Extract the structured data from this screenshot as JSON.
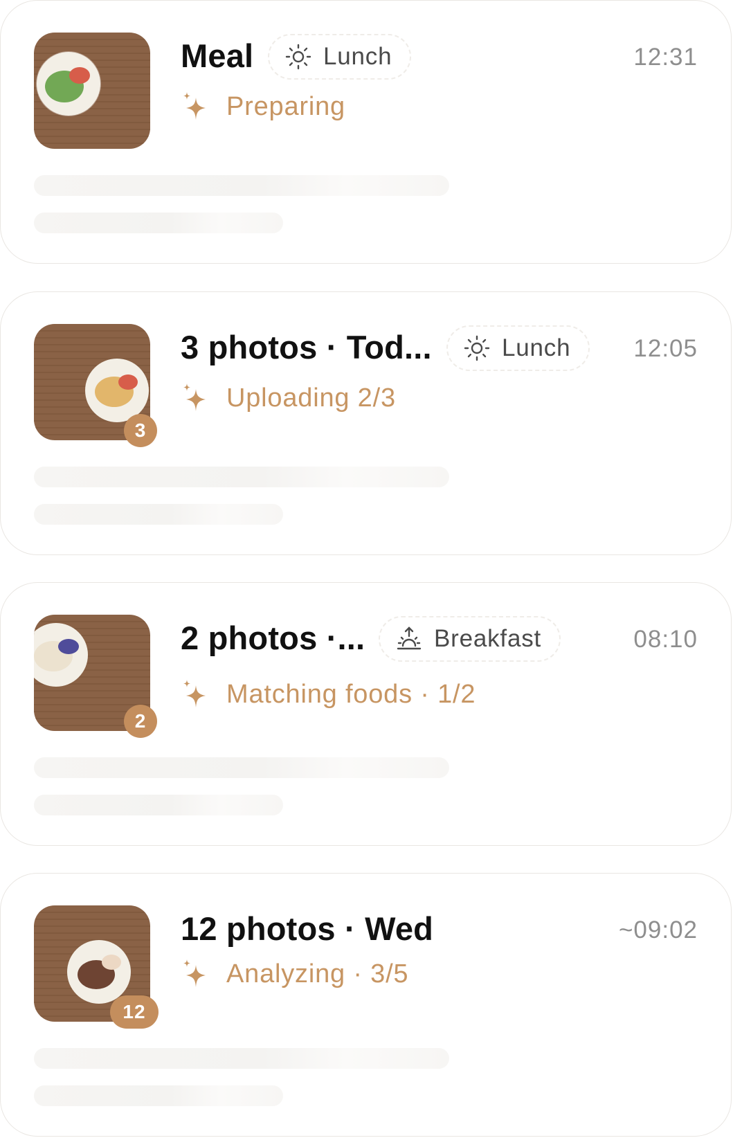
{
  "colors": {
    "accent": "#c79562",
    "badge": "#c48e5d",
    "board": "#8a6246",
    "title": "#111111",
    "time": "#8e8e8e",
    "chip_text": "#4a4a4a"
  },
  "cards": [
    {
      "title": "Meal",
      "chip": {
        "label": "Lunch",
        "icon": "sun-icon"
      },
      "time": "12:31",
      "status": {
        "label": "Preparing",
        "icon": "sparkle-icon"
      },
      "photo_count": "",
      "thumbnail": "green-salad-plate"
    },
    {
      "title": "3 photos · Tod...",
      "chip": {
        "label": "Lunch",
        "icon": "sun-icon"
      },
      "time": "12:05",
      "status": {
        "label": "Uploading 2/3",
        "icon": "sparkle-icon"
      },
      "photo_count": "3",
      "thumbnail": "yellow-food-plate"
    },
    {
      "title": "2 photos ·...",
      "chip": {
        "label": "Breakfast",
        "icon": "sunrise-icon"
      },
      "time": "08:10",
      "status": {
        "label": "Matching foods · 1/2",
        "icon": "sparkle-icon"
      },
      "photo_count": "2",
      "thumbnail": "berry-plate"
    },
    {
      "title": "12 photos · Wed",
      "chip": null,
      "time": "~09:02",
      "status": {
        "label": "Analyzing · 3/5",
        "icon": "sparkle-icon"
      },
      "photo_count": "12",
      "thumbnail": "brown-food-plate"
    }
  ]
}
